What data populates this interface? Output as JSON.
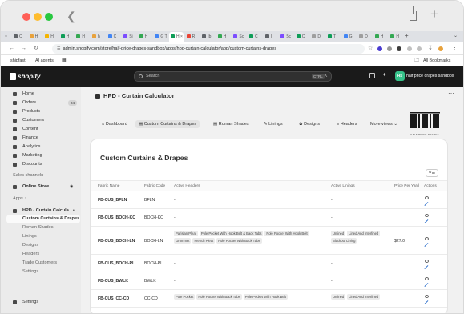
{
  "browser": {
    "tabs": [
      "C",
      "H",
      "H",
      "H",
      "H",
      "h",
      "C",
      "Si",
      "H",
      "G Te",
      "H ×",
      "R",
      "Ib",
      "H",
      "Sc",
      "C",
      "I",
      "Sc",
      "C",
      "D",
      "T",
      "G",
      "D",
      "H",
      "H"
    ],
    "url": "admin.shopify.com/store/half-price-drapes-sandbox/apps/hpd-curtain-calculator/app/custom-curtains-drapes",
    "bookmarks": [
      "shipfast",
      "AI agents"
    ],
    "all_bookmarks": "All Bookmarks"
  },
  "shopify": {
    "logo": "shopify",
    "search_placeholder": "Search",
    "shortcut": "CTRL",
    "shortcut_key": "K",
    "store_initials": "HS",
    "store_name": "half price drapes sandbox"
  },
  "sidebar": {
    "items": [
      {
        "label": "Home"
      },
      {
        "label": "Orders",
        "badge": "24"
      },
      {
        "label": "Products"
      },
      {
        "label": "Customers"
      },
      {
        "label": "Content"
      },
      {
        "label": "Finance"
      },
      {
        "label": "Analytics"
      },
      {
        "label": "Marketing"
      },
      {
        "label": "Discounts"
      }
    ],
    "sales_channels": "Sales channels",
    "online_store": "Online Store",
    "apps": "Apps",
    "app_name": "HPD - Curtain Calcula...",
    "app_subitems": [
      "Custom Curtains & Drapes",
      "Roman Shades",
      "Linings",
      "Designs",
      "Headers",
      "Trade Customers",
      "Settings"
    ],
    "settings": "Settings"
  },
  "page": {
    "title": "HPD - Curtain Calculator",
    "nav": [
      "Dashboard",
      "Custom Curtains & Drapes",
      "Roman Shades",
      "Linings",
      "Designs",
      "Headers",
      "More views"
    ],
    "logo_text": "HALF PRICE DRAPES"
  },
  "table": {
    "title": "Custom Curtains & Drapes",
    "headers": [
      "Fabric Name",
      "Fabric Code",
      "Active Headers",
      "Active Linings",
      "Price Per Yard",
      "Actions"
    ],
    "rows": [
      {
        "name": "FB-CUS_BFLN",
        "code": "BFLN",
        "headers": [
          "-"
        ],
        "linings": [
          "-"
        ],
        "price": ""
      },
      {
        "name": "FB-CUS_BOCH-KC",
        "code": "BOCH-KC",
        "headers": [
          "-"
        ],
        "linings": [
          "-"
        ],
        "price": ""
      },
      {
        "name": "FB-CUS_BOCH-LN",
        "code": "BOCH-LN",
        "headers": [
          "Parisian Pleat",
          "Pole Pocket With Hook Belt & Back Tabs",
          "Pole Pocket With Hook Belt",
          "Grommet",
          "French Pleat",
          "Pole Pocket With Back Tabs"
        ],
        "linings": [
          "Unlined",
          "Lined And Interlined",
          "Blackout Lining"
        ],
        "price": "$27.0"
      },
      {
        "name": "FB-CUS_BOCH-PL",
        "code": "BOCH-PL",
        "headers": [
          "-"
        ],
        "linings": [
          "-"
        ],
        "price": ""
      },
      {
        "name": "FB-CUS_BWLK",
        "code": "BWLK",
        "headers": [
          "-"
        ],
        "linings": [
          "-"
        ],
        "price": ""
      },
      {
        "name": "FB-CUS_CC-CD",
        "code": "CC-CD",
        "headers": [
          "Pole Pocket",
          "Pole Pocket With Back Tabs",
          "Pole Pocket With Hook Belt"
        ],
        "linings": [
          "Unlined",
          "Lined And Interlined"
        ],
        "price": ""
      }
    ]
  }
}
